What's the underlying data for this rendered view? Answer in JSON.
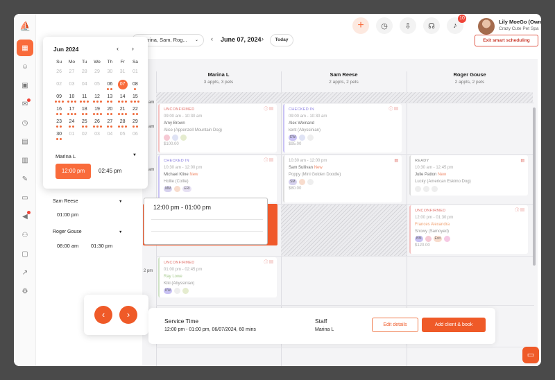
{
  "header": {
    "user_name": "Lily MoeGo (Owner)",
    "business": "Crazy Cute Pet Spa",
    "notification_count": "10"
  },
  "toolbar": {
    "staff_filter": "Marina, Sam, Rog...",
    "date": "June 07, 2024",
    "today": "Today",
    "exit": "Exit smart scheduling"
  },
  "datepicker": {
    "month": "Jun 2024",
    "weekdays": [
      "Su",
      "Mo",
      "Tu",
      "We",
      "Th",
      "Fr",
      "Sa"
    ],
    "days": [
      {
        "d": "26",
        "m": true
      },
      {
        "d": "27",
        "m": true
      },
      {
        "d": "28",
        "m": true
      },
      {
        "d": "29",
        "m": true
      },
      {
        "d": "30",
        "m": true
      },
      {
        "d": "31",
        "m": true
      },
      {
        "d": "01",
        "m": true
      },
      {
        "d": "02",
        "m": true
      },
      {
        "d": "03",
        "m": true
      },
      {
        "d": "04",
        "m": true
      },
      {
        "d": "05",
        "m": true
      },
      {
        "d": "06",
        "dots": 2
      },
      {
        "d": "07",
        "sel": true
      },
      {
        "d": "08",
        "dots": 1
      },
      {
        "d": "09",
        "dots": 3
      },
      {
        "d": "10",
        "dots": 3
      },
      {
        "d": "11",
        "dots": 3
      },
      {
        "d": "12",
        "dots": 3
      },
      {
        "d": "13",
        "dots": 2
      },
      {
        "d": "14",
        "dots": 3
      },
      {
        "d": "15",
        "dots": 3
      },
      {
        "d": "16",
        "dots": 2
      },
      {
        "d": "17",
        "dots": 3
      },
      {
        "d": "18",
        "dots": 2
      },
      {
        "d": "19",
        "dots": 3
      },
      {
        "d": "20",
        "dots": 2
      },
      {
        "d": "21",
        "dots": 3
      },
      {
        "d": "22",
        "dots": 2
      },
      {
        "d": "23",
        "dots": 2
      },
      {
        "d": "24",
        "dots": 2
      },
      {
        "d": "25",
        "dots": 2
      },
      {
        "d": "26",
        "dots": 3
      },
      {
        "d": "27",
        "dots": 2
      },
      {
        "d": "28",
        "dots": 3
      },
      {
        "d": "29",
        "dots": 2
      },
      {
        "d": "30",
        "dots": 2
      },
      {
        "d": "01",
        "m": true
      },
      {
        "d": "02",
        "m": true
      },
      {
        "d": "03",
        "m": true
      },
      {
        "d": "04",
        "m": true
      },
      {
        "d": "05",
        "m": true
      },
      {
        "d": "06",
        "m": true
      }
    ],
    "staff": "Marina L",
    "slot_selected": "12:00 pm",
    "slot_other": "02:45 pm"
  },
  "staff_list": [
    {
      "name": "Sam Reese",
      "times": [
        "01:00 pm"
      ]
    },
    {
      "name": "Roger Gouse",
      "times": [
        "08:00 am",
        "01:30 pm"
      ]
    }
  ],
  "columns": [
    {
      "name": "Marina L",
      "sub": "3 appts, 3 pets"
    },
    {
      "name": "Sam Reese",
      "sub": "2 appts, 2 pets"
    },
    {
      "name": "Roger Gouse",
      "sub": "2 appts, 2 pets"
    }
  ],
  "time_labels": [
    "am",
    "am",
    "am",
    "2 pm"
  ],
  "appointments": [
    {
      "status": "UNCONFIRMED",
      "time": "09:00 am - 10:30 am",
      "client": "Amy Brown",
      "pet": "Alice (Appenzell Mountain Dog)",
      "price": "$100.00",
      "tags": [
        "",
        "",
        ""
      ]
    },
    {
      "status": "CHECKED IN",
      "time": "09:00 am - 10:30 am",
      "client": "Alex Weinand",
      "pet": "kent (Abyssinian)",
      "price": "$95.00",
      "tags": [
        "EW",
        "",
        ""
      ]
    },
    {
      "status": "CHECKED IN",
      "time": "10:30 am - 12:00 pm",
      "client": "Michael Kline",
      "new": "New",
      "pet": "Hollie (Collie)",
      "tags": [
        "MM",
        "",
        "ERI"
      ]
    },
    {
      "status": "",
      "time": "10:30 am - 12:00 pm",
      "client": "Sam Sullivan",
      "new": "New",
      "pet": "Poppy (Mini Golden Doodle)",
      "price": "$80.00",
      "tags": [
        "SM",
        "",
        ""
      ]
    },
    {
      "status": "READY",
      "time": "10:30 am - 12:45 pm",
      "client": "Julie Patton",
      "new": "New",
      "pet": "Lucky (American Eskimo Dog)",
      "tags": [
        "",
        "",
        ""
      ]
    },
    {
      "status": "UNCONFIRMED",
      "time": "12:00 pm - 01:30 pm",
      "client": "Frances Alexandra",
      "pet": "Snowy (Samoyed)",
      "price": "$120.00",
      "tags": [
        "BM",
        "",
        "Exit",
        ""
      ]
    },
    {
      "status": "UNCONFIRMED",
      "time": "01:00 pm - 02:45 pm",
      "client": "Ray Lowe",
      "pet": "Kiki (Abyssinian)",
      "tags": [
        "KW",
        "",
        ""
      ]
    }
  ],
  "selection": {
    "range": "12:00 pm - 01:00 pm"
  },
  "bottom": {
    "service_label": "Service Time",
    "service_value": "12:00 pm - 01:00 pm, 06/07/2024, 60 mins",
    "staff_label": "Staff",
    "staff_value": "Marina L",
    "edit": "Edit details",
    "add": "Add client & book"
  },
  "colors": {
    "accent": "#ef5a28",
    "danger": "#e05a4a"
  }
}
